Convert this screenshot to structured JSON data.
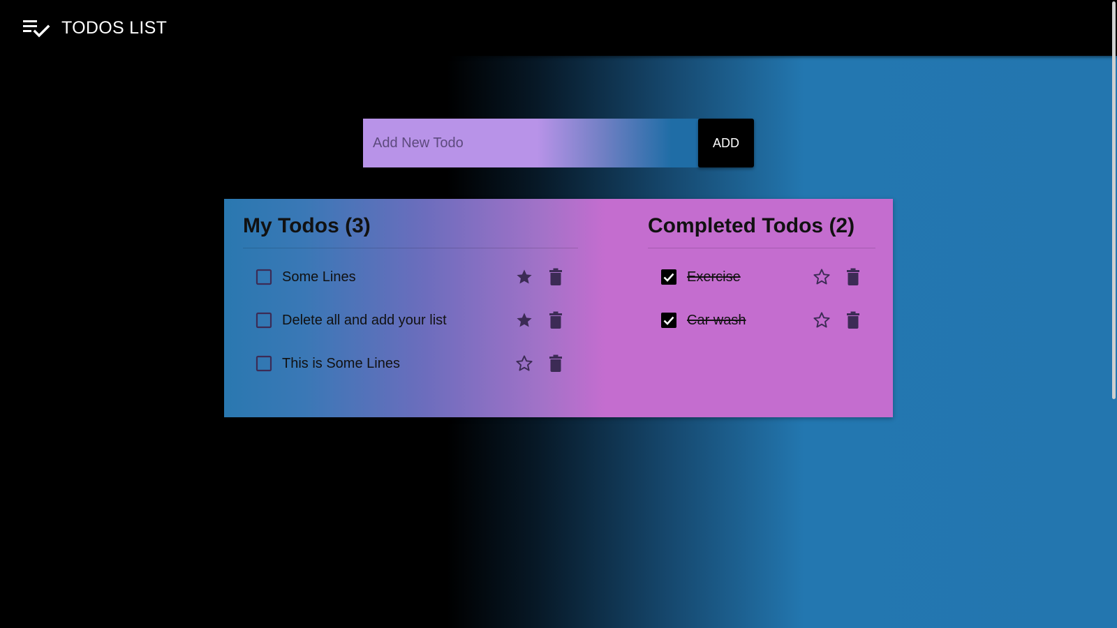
{
  "app": {
    "title": "TODOS LIST",
    "logo_icon": "playlist-check-icon"
  },
  "add_form": {
    "placeholder": "Add New Todo",
    "value": "",
    "button_label": "ADD"
  },
  "my_todos": {
    "title": "My Todos (3)",
    "items": [
      {
        "text": "Some Lines",
        "checked": false,
        "starred": true
      },
      {
        "text": "Delete all and add your list",
        "checked": false,
        "starred": true
      },
      {
        "text": "This is Some Lines",
        "checked": false,
        "starred": false
      }
    ]
  },
  "completed_todos": {
    "title": "Completed Todos (2)",
    "items": [
      {
        "text": "Exercise",
        "checked": true,
        "starred": false
      },
      {
        "text": "Car wash",
        "checked": true,
        "starred": false
      }
    ]
  },
  "colors": {
    "appbar": "#000000",
    "icon": "#3c2b55",
    "checkbox_checked": "#000000"
  }
}
